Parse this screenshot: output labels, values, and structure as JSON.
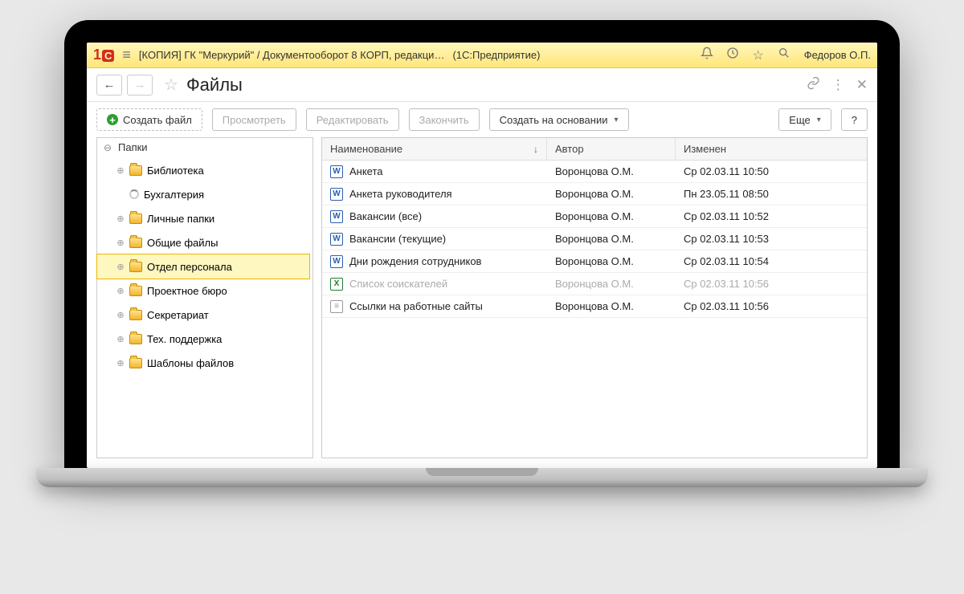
{
  "titlebar": {
    "title": "[КОПИЯ] ГК \"Меркурий\" / Документооборот 8 КОРП, редакци…",
    "suffix": "(1С:Предприятие)",
    "user": "Федоров О.П."
  },
  "page": {
    "title": "Файлы"
  },
  "toolbar": {
    "create": "Создать файл",
    "view": "Просмотреть",
    "edit": "Редактировать",
    "finish": "Закончить",
    "create_based": "Создать на основании",
    "more": "Еще",
    "help": "?"
  },
  "tree": {
    "root": "Папки",
    "items": [
      {
        "label": "Библиотека",
        "icon": "folder",
        "expand": "⊕"
      },
      {
        "label": "Бухгалтерия",
        "icon": "loading",
        "expand": ""
      },
      {
        "label": "Личные папки",
        "icon": "folder",
        "expand": "⊕"
      },
      {
        "label": "Общие файлы",
        "icon": "folder",
        "expand": "⊕"
      },
      {
        "label": "Отдел персонала",
        "icon": "folder",
        "expand": "⊕",
        "selected": true
      },
      {
        "label": "Проектное бюро",
        "icon": "folder",
        "expand": "⊕"
      },
      {
        "label": "Секретариат",
        "icon": "folder",
        "expand": "⊕"
      },
      {
        "label": "Тех. поддержка",
        "icon": "folder",
        "expand": "⊕"
      },
      {
        "label": "Шаблоны файлов",
        "icon": "folder",
        "expand": "⊕"
      }
    ]
  },
  "table": {
    "columns": {
      "name": "Наименование",
      "author": "Автор",
      "modified": "Изменен"
    },
    "rows": [
      {
        "icon": "word",
        "name": "Анкета",
        "author": "Воронцова О.М.",
        "date": "Ср 02.03.11 10:50"
      },
      {
        "icon": "word",
        "name": "Анкета руководителя",
        "author": "Воронцова О.М.",
        "date": "Пн 23.05.11 08:50"
      },
      {
        "icon": "word",
        "name": "Вакансии (все)",
        "author": "Воронцова О.М.",
        "date": "Ср 02.03.11 10:52"
      },
      {
        "icon": "word",
        "name": "Вакансии (текущие)",
        "author": "Воронцова О.М.",
        "date": "Ср 02.03.11 10:53"
      },
      {
        "icon": "word",
        "name": "Дни рождения сотрудников",
        "author": "Воронцова О.М.",
        "date": "Ср 02.03.11 10:54"
      },
      {
        "icon": "excel",
        "name": "Список соискателей",
        "author": "Воронцова О.М.",
        "date": "Ср 02.03.11 10:56",
        "muted": true
      },
      {
        "icon": "text",
        "name": "Ссылки на работные сайты",
        "author": "Воронцова О.М.",
        "date": "Ср 02.03.11 10:56"
      }
    ]
  }
}
